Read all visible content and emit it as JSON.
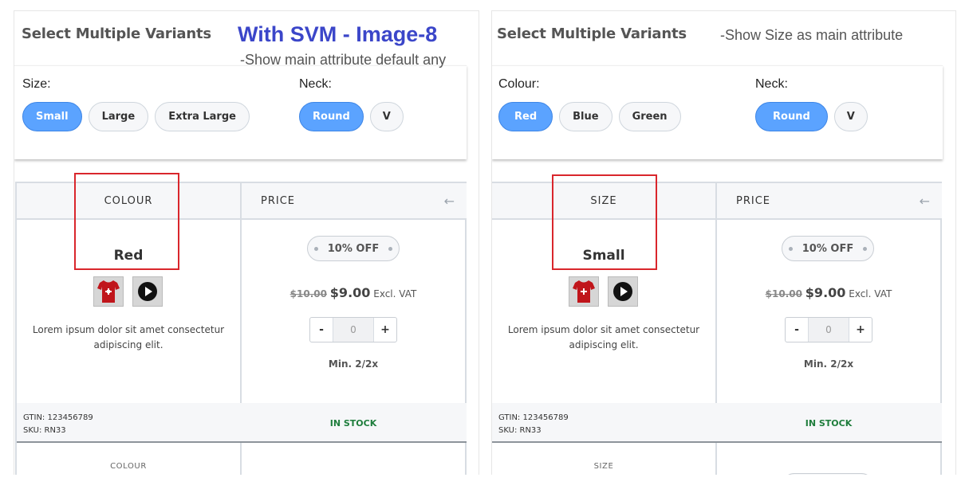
{
  "left": {
    "title": "Select Multiple Variants",
    "annotation_title": "With SVM - Image-8",
    "annotation_sub": "-Show main attribute default any",
    "group1": {
      "label": "Size:",
      "options": [
        "Small",
        "Large",
        "Extra Large"
      ],
      "selected": "Small"
    },
    "group2": {
      "label": "Neck:",
      "options": [
        "Round",
        "V"
      ],
      "selected": "Round"
    },
    "table": {
      "col1": "COLOUR",
      "col2": "PRICE",
      "variant": "Red",
      "description": "Lorem ipsum dolor sit amet consectetur adipiscing elit.",
      "discount": "10% OFF",
      "old_price": "$10.00",
      "new_price": "$9.00",
      "vat": "Excl. VAT",
      "qty": "0",
      "minus": "-",
      "plus": "+",
      "min": "Min. 2/2x",
      "gtin": "GTIN: 123456789",
      "sku": "SKU: RN33",
      "stock": "IN STOCK",
      "next_row_label": "COLOUR"
    }
  },
  "right": {
    "title": "Select Multiple Variants",
    "annotation_sub": "-Show Size as main attribute",
    "group1": {
      "label": "Colour:",
      "options": [
        "Red",
        "Blue",
        "Green"
      ],
      "selected": "Red"
    },
    "group2": {
      "label": "Neck:",
      "options": [
        "Round",
        "V"
      ],
      "selected": "Round"
    },
    "table": {
      "col1": "SIZE",
      "col2": "PRICE",
      "variant": "Small",
      "description": "Lorem ipsum dolor sit amet consectetur adipiscing elit.",
      "discount": "10% OFF",
      "old_price": "$10.00",
      "new_price": "$9.00",
      "vat": "Excl. VAT",
      "qty": "0",
      "minus": "-",
      "plus": "+",
      "min": "Min. 2/2x",
      "gtin": "GTIN: 123456789",
      "sku": "SKU: RN33",
      "stock": "IN STOCK",
      "next_row_label": "SIZE"
    }
  },
  "icons": {
    "back": "arrow-left-icon",
    "product": "red-tshirt-icon",
    "video": "play-icon"
  },
  "colors": {
    "accent": "#5ba3ff",
    "annotation": "#3b46c9",
    "highlight": "#d9262c",
    "stock": "#1e7d3c"
  }
}
